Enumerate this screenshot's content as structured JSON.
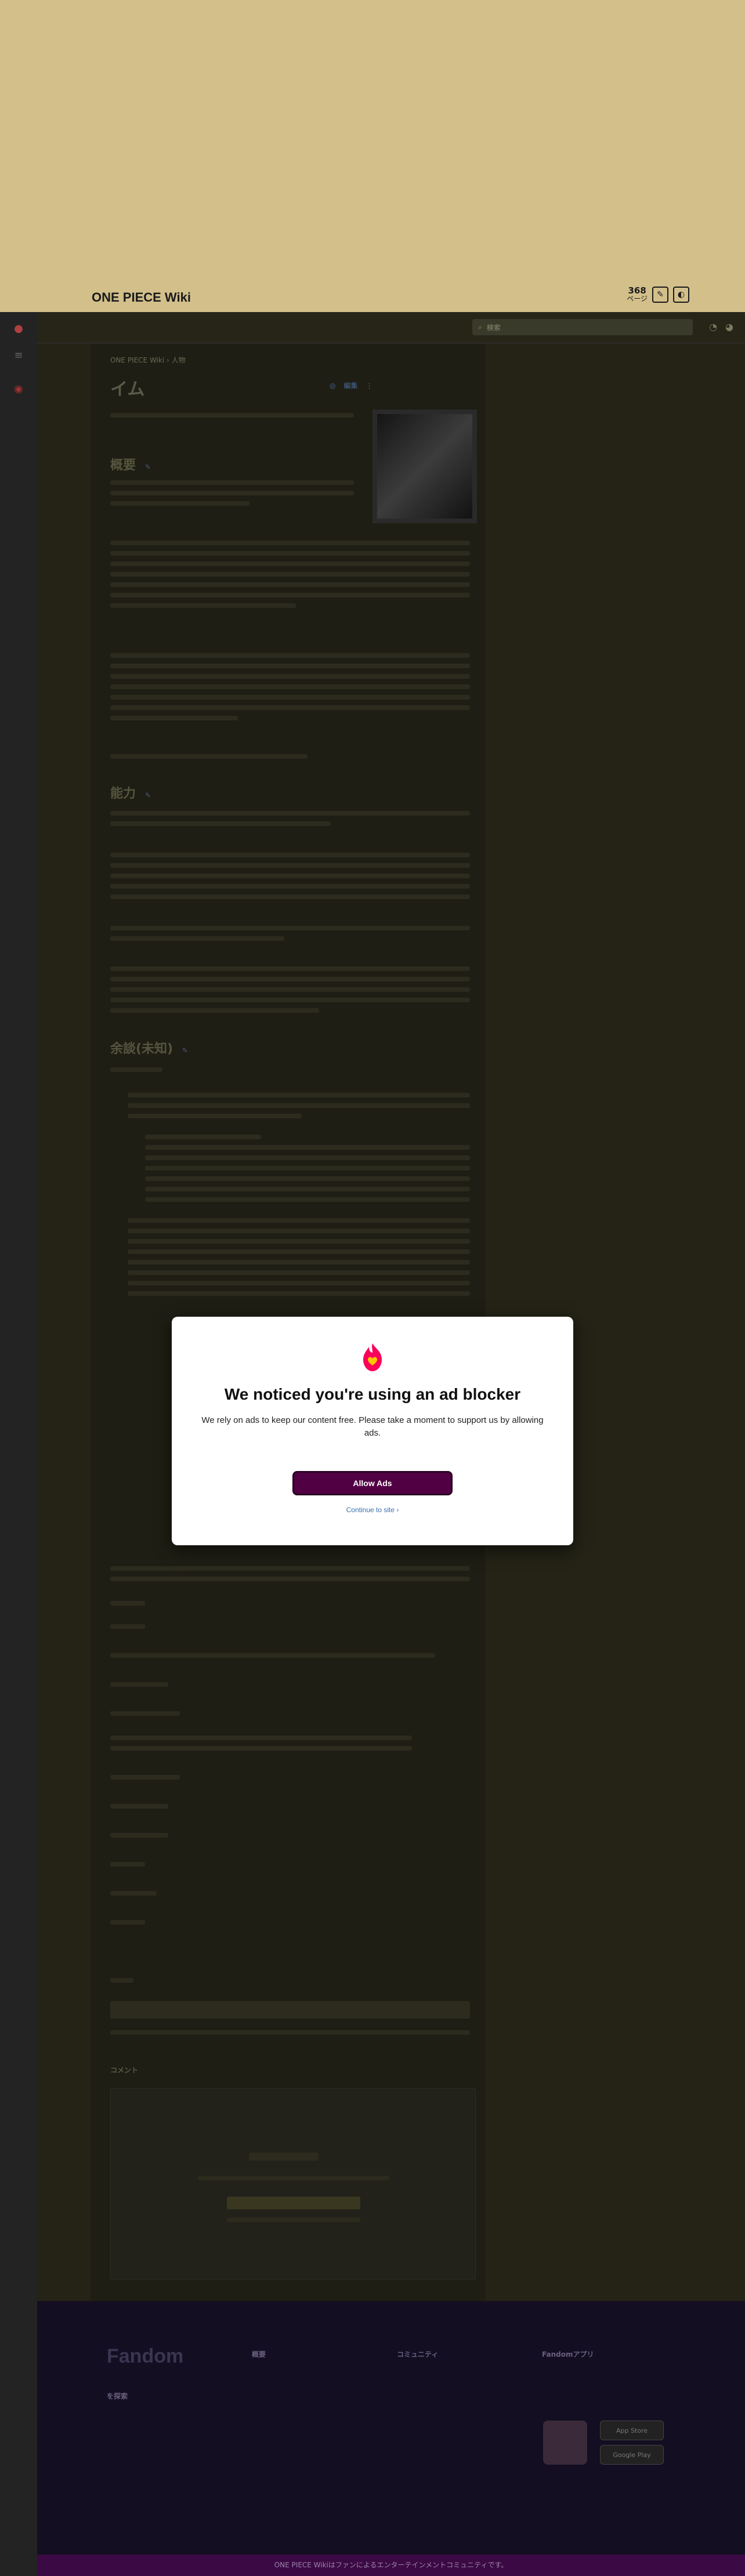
{
  "hero": {
    "title": "ONE PIECE Wiki",
    "page_count": "368",
    "page_count_label": "ページ"
  },
  "wikinav": {
    "search_placeholder": "検索"
  },
  "article": {
    "breadcrumb": "ONE PIECE Wiki › 人物",
    "title": "イム",
    "edit_label": "編集",
    "sections": [
      {
        "heading": "概要",
        "edit": "✎"
      },
      {
        "heading": "能力",
        "edit": "✎"
      },
      {
        "heading": "余談(未知)",
        "edit": "✎"
      }
    ],
    "comments_title": "コメント"
  },
  "modal": {
    "title": "We noticed you're using an ad blocker",
    "text": "We rely on ads to keep our content free. Please take a moment to support us by allowing ads.",
    "allow_button": "Allow Ads",
    "continue_link": "Continue to site ›"
  },
  "footer": {
    "logo": "Fandom",
    "columns": [
      {
        "heading": "を探索"
      },
      {
        "heading": "概要"
      },
      {
        "heading": "コミュニティ"
      },
      {
        "heading": "Fandomアプリ"
      }
    ],
    "store_badges": [
      "App Store",
      "Google Play"
    ],
    "bottom_text": "ONE PIECE Wikiはファンによるエンターテインメントコミュニティです。"
  }
}
